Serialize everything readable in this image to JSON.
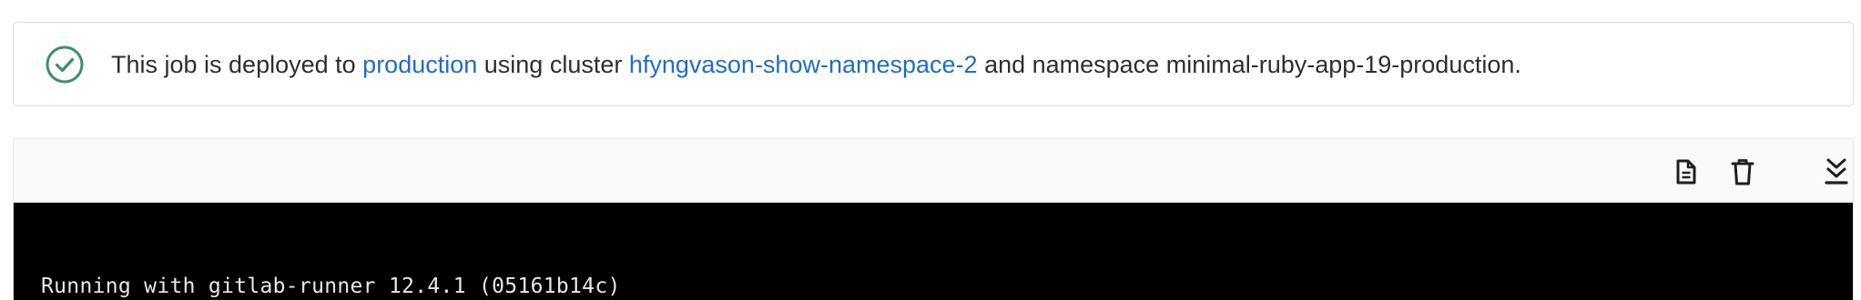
{
  "deploy_alert": {
    "text_before": "This job is deployed to ",
    "environment_link": "production",
    "text_middle": " using cluster ",
    "cluster_link": "hfyngvason-show-namespace-2",
    "text_after": " and namespace minimal-ruby-app-19-production.",
    "icon": "check-circle-icon",
    "icon_color": "#3e8e6e",
    "link_color": "#1f6fbf"
  },
  "job_log": {
    "toolbar": {
      "raw_icon": "file-text-icon",
      "erase_icon": "trash-icon",
      "scroll_icon": "scroll-to-bottom-icon"
    },
    "lines": [
      "Running with gitlab-runner 12.4.1 (05161b14c)"
    ],
    "background_color": "#000000"
  }
}
